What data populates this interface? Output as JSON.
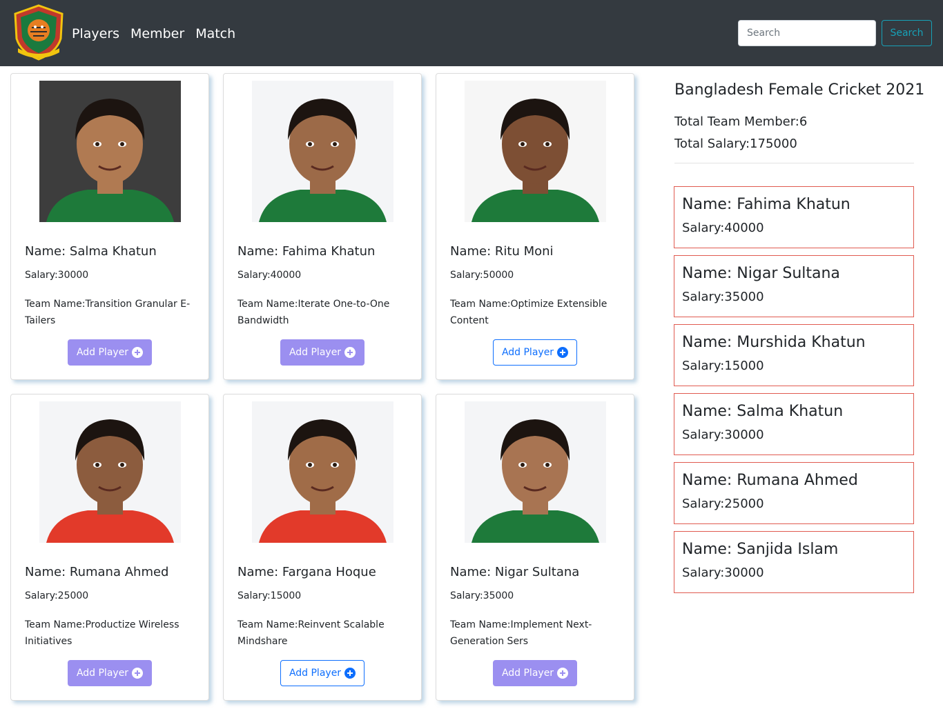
{
  "nav": {
    "logo_alt": "Bangladesh Cricket Board",
    "links": [
      "Players",
      "Member",
      "Match"
    ],
    "search_placeholder": "Search",
    "search_button": "Search"
  },
  "players": [
    {
      "name": "Name: Salma Khatun",
      "salary": "Salary:30000",
      "team": "Team Name:Transition Granular E-Tailers",
      "button": "Add Player",
      "button_style": "filled",
      "jersey": "green",
      "bg": "#3d3d3d",
      "skin": "#b07a52"
    },
    {
      "name": "Name: Fahima Khatun",
      "salary": "Salary:40000",
      "team": "Team Name:Iterate One-to-One Bandwidth",
      "button": "Add Player",
      "button_style": "filled",
      "jersey": "green",
      "bg": "#f4f5f7",
      "skin": "#9c6a48"
    },
    {
      "name": "Name: Ritu Moni",
      "salary": "Salary:50000",
      "team": "Team Name:Optimize Extensible Content",
      "button": "Add Player",
      "button_style": "outline",
      "jersey": "green",
      "bg": "#f6f6f6",
      "skin": "#7d4f34"
    },
    {
      "name": "Name: Rumana Ahmed",
      "salary": "Salary:25000",
      "team": "Team Name:Productize Wireless Initiatives",
      "button": "Add Player",
      "button_style": "filled",
      "jersey": "red",
      "bg": "#f4f5f7",
      "skin": "#8c5c3e"
    },
    {
      "name": "Name: Fargana Hoque",
      "salary": "Salary:15000",
      "team": "Team Name:Reinvent Scalable Mindshare",
      "button": "Add Player",
      "button_style": "outline",
      "jersey": "red",
      "bg": "#f4f5f7",
      "skin": "#a06c48"
    },
    {
      "name": "Name: Nigar Sultana",
      "salary": "Salary:35000",
      "team": "Team Name:Implement Next-Generation Sers",
      "button": "Add Player",
      "button_style": "filled",
      "jersey": "green",
      "bg": "#f4f5f7",
      "skin": "#a87452"
    }
  ],
  "summary": {
    "title": "Bangladesh Female Cricket 2021",
    "total_members": "Total Team Member:6",
    "total_salary": "Total Salary:175000"
  },
  "members": [
    {
      "name": "Name: Fahima Khatun",
      "salary": "Salary:40000"
    },
    {
      "name": "Name: Nigar Sultana",
      "salary": "Salary:35000"
    },
    {
      "name": "Name: Murshida Khatun",
      "salary": "Salary:15000"
    },
    {
      "name": "Name: Salma Khatun",
      "salary": "Salary:30000"
    },
    {
      "name": "Name: Rumana Ahmed",
      "salary": "Salary:25000"
    },
    {
      "name": "Name: Sanjida Islam",
      "salary": "Salary:30000"
    }
  ],
  "colors": {
    "navbar": "#343a40",
    "filled_button": "#9b8ff0",
    "outline_button": "#0d6efd",
    "search_button": "#17a2b8",
    "member_border": "#e05a50",
    "jersey_green": "#1e7a3a",
    "jersey_red": "#e23a2a"
  }
}
